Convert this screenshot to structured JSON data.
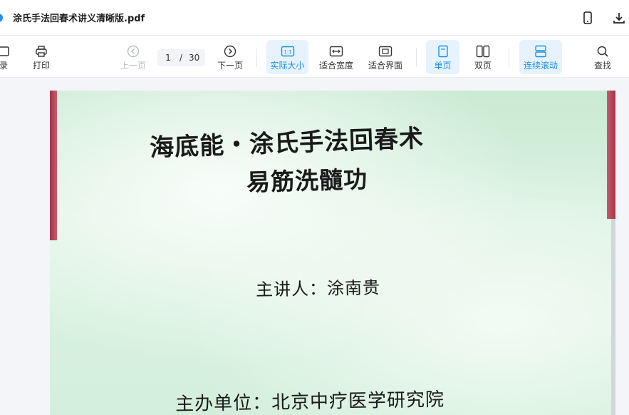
{
  "titlebar": {
    "doc_title": "涂氏手法回春术讲义清晰版.pdf"
  },
  "toolbar": {
    "contents_label": "录",
    "print_label": "打印",
    "prev_label": "上一页",
    "current_page": "1",
    "page_sep": "/",
    "total_pages": "30",
    "next_label": "下一页",
    "actual_size_label": "实际大小",
    "actual_size_icon_text": "1:1",
    "fit_width_label": "适合宽度",
    "fit_page_label": "适合界面",
    "single_page_label": "单页",
    "double_page_label": "双页",
    "continuous_label": "连续滚动",
    "search_label": "查找"
  },
  "document": {
    "title_line1": "海底能・涂氏手法回春术",
    "title_line2": "易筋洗髓功",
    "lecturer": "主讲人：涂南贵",
    "organizer": "主办单位：北京中疗医学研究院"
  },
  "colors": {
    "accent": "#1a8fe0",
    "active_bg": "#e6f3fe",
    "disabled": "#b9bcc4"
  }
}
